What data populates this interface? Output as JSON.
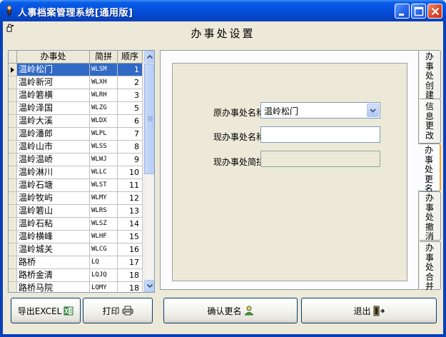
{
  "window": {
    "title": "人事档案管理系统[通用版]"
  },
  "page_title": "办事处设置",
  "grid": {
    "columns": [
      "办事处",
      "简拼",
      "顺序"
    ],
    "rows": [
      {
        "name": "温岭松门",
        "code": "WLSM",
        "order": "1",
        "selected": true
      },
      {
        "name": "温岭新河",
        "code": "WLXH",
        "order": "2"
      },
      {
        "name": "温岭箬横",
        "code": "WLRH",
        "order": "3"
      },
      {
        "name": "温岭泽国",
        "code": "WLZG",
        "order": "5"
      },
      {
        "name": "温岭大溪",
        "code": "WLDX",
        "order": "6"
      },
      {
        "name": "温岭潘郎",
        "code": "WLPL",
        "order": "7"
      },
      {
        "name": "温岭山市",
        "code": "WLSS",
        "order": "8"
      },
      {
        "name": "温岭温峤",
        "code": "WLWJ",
        "order": "9"
      },
      {
        "name": "温岭淋川",
        "code": "WLLC",
        "order": "10"
      },
      {
        "name": "温岭石塘",
        "code": "WLST",
        "order": "11"
      },
      {
        "name": "温岭牧屿",
        "code": "WLMY",
        "order": "12"
      },
      {
        "name": "温岭箬山",
        "code": "WLRS",
        "order": "13"
      },
      {
        "name": "温岭石粘",
        "code": "WLSZ",
        "order": "14"
      },
      {
        "name": "温岭横峰",
        "code": "WLHF",
        "order": "15"
      },
      {
        "name": "温岭城关",
        "code": "WLCG",
        "order": "16"
      },
      {
        "name": "路桥",
        "code": "LQ",
        "order": "17"
      },
      {
        "name": "路桥金清",
        "code": "LQJQ",
        "order": "18"
      },
      {
        "name": "路桥马院",
        "code": "LQMY",
        "order": "18"
      }
    ]
  },
  "form": {
    "original_label": "原办事处名称:",
    "original_value": "温岭松门",
    "current_label": "现办事处名称:",
    "current_value": "",
    "pinyin_label": "现办事处简拼:",
    "pinyin_value": ""
  },
  "tabs": [
    {
      "label": "办事处创建",
      "active": false
    },
    {
      "label": "信息更改",
      "active": false
    },
    {
      "label": "办事处更名",
      "active": true
    },
    {
      "label": "办事处撤消",
      "active": false
    },
    {
      "label": "办事处合并",
      "active": false
    }
  ],
  "buttons": {
    "export": "导出EXCEL",
    "print": "打印",
    "confirm": "确认更名",
    "exit": "退出"
  },
  "icons": {
    "app": "person-figure-icon",
    "export": "excel-icon",
    "print": "printer-icon",
    "confirm": "user-icon",
    "exit": "exit-door-icon"
  },
  "colors": {
    "titlebar": "#0550dc",
    "selection": "#316ac5",
    "active_tab_accent": "#f6a430"
  }
}
